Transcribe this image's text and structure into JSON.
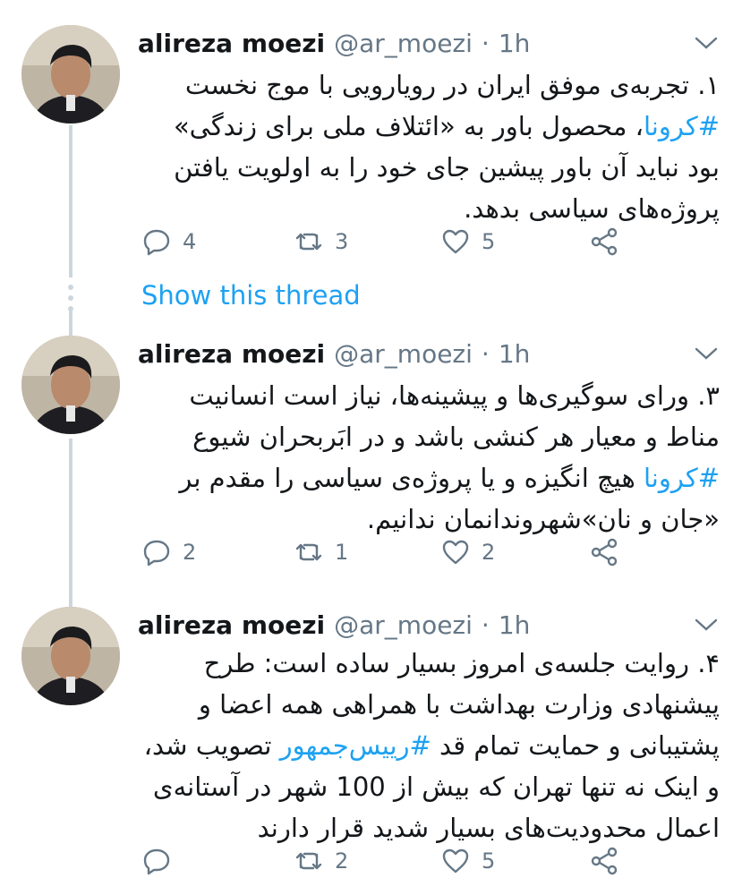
{
  "thread": {
    "show_thread_label": "Show this thread"
  },
  "tweets": [
    {
      "author_name": "alireza moezi",
      "handle": "@ar_moezi",
      "separator": "·",
      "time": "1h",
      "text_parts": [
        "۱. تجربه‌ی موفق ایران در رویارویی با موج نخست ",
        "#کرونا",
        "، محصول باور به «ائتلاف ملی برای زندگی» بود نباید آن باور پیشین جای خود را به اولویت یافتن پروژه‌های سیاسی بدهد."
      ],
      "replies": "4",
      "retweets": "3",
      "likes": "5"
    },
    {
      "author_name": "alireza moezi",
      "handle": "@ar_moezi",
      "separator": "·",
      "time": "1h",
      "text_parts": [
        "۳. ورای سوگیری‌ها و پیشینه‌ها، نیاز است انسانیت مناط و معیار هر کنشی باشد و در ابَربحران شیوع ",
        "#کرونا",
        " هیچ انگیزه و یا پروژه‌ی سیاسی را مقدم بر «جان و نان»شهروندانمان ندانیم."
      ],
      "replies": "2",
      "retweets": "1",
      "likes": "2"
    },
    {
      "author_name": "alireza moezi",
      "handle": "@ar_moezi",
      "separator": "·",
      "time": "1h",
      "text_parts": [
        "۴. روایت جلسه‌ی امروز بسیار ساده است: طرح پیشنهادی وزارت بهداشت با همراهی همه اعضا و پشتیبانی و حمایت تمام قد ",
        "#رییس‌جمهور",
        " تصویب شد، و اینک نه تنها تهران که بیش از 100 شهر در آستانه‌ی اعمال محدودیت‌های بسیار شدید قرار دارند"
      ],
      "replies": "",
      "retweets": "2",
      "likes": "5"
    }
  ],
  "icons": {
    "avatar": "profile-photo",
    "chevron": "chevron-down-icon",
    "reply": "reply-icon",
    "retweet": "retweet-icon",
    "like": "heart-icon",
    "share": "share-icon"
  },
  "colors": {
    "link": "#1da1f2",
    "muted": "#657786",
    "thread_line": "#ccd6dd"
  }
}
